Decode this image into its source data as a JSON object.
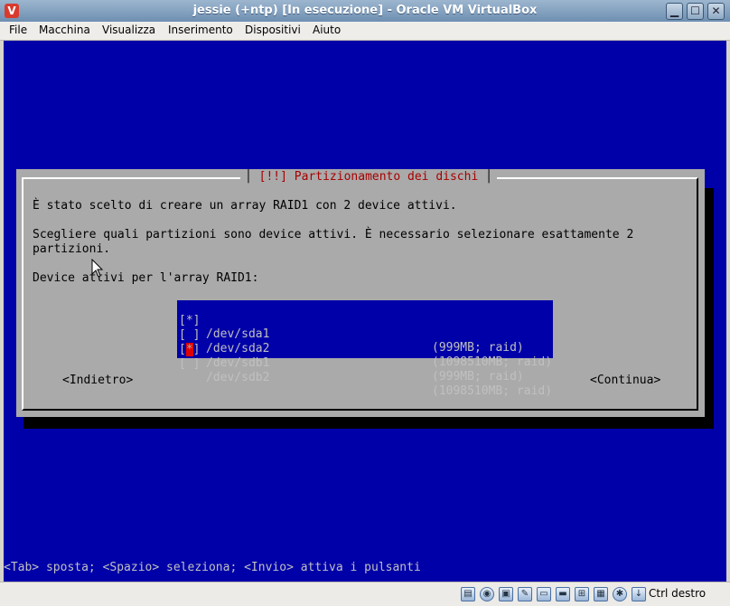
{
  "window": {
    "title": "jessie (+ntp) [In esecuzione] - Oracle VM VirtualBox",
    "app_icon": "virtualbox-icon",
    "controls": [
      "minimize",
      "maximize",
      "close"
    ]
  },
  "menu": [
    "File",
    "Macchina",
    "Visualizza",
    "Inserimento",
    "Dispositivi",
    "Aiuto"
  ],
  "dialog": {
    "title_left": "[!!] ",
    "title_text": "Partizionamento dei dischi",
    "line1": "È stato scelto di creare un array RAID1 con 2 device attivi.",
    "line2a": "Scegliere quali partizioni sono device attivi. È necessario selezionare esattamente 2",
    "line2b": "partizioni.",
    "line3": "Device attivi per l'array RAID1:",
    "partitions": [
      {
        "check": "[*]",
        "device": "/dev/sda1",
        "info": "(999MB; raid)"
      },
      {
        "check": "[ ]",
        "device": "/dev/sda2",
        "info": "(1098510MB; raid)"
      },
      {
        "check": "[*]",
        "device": "/dev/sdb1",
        "info": "(999MB; raid)"
      },
      {
        "check": "[ ]",
        "device": "/dev/sdb2",
        "info": "(1098510MB; raid)"
      }
    ],
    "back_button": "<Indietro>",
    "continue_button": "<Continua>"
  },
  "help_line": "<Tab> sposta; <Spazio> seleziona; <Invio> attiva i pulsanti",
  "statusbar": {
    "host_key": "Ctrl destro",
    "icons": [
      "hdd-icon",
      "cd-icon",
      "floppy-icon",
      "usb-icon",
      "shared-folder-icon",
      "display-icon",
      "network-icon",
      "video-capture-icon",
      "cpu-icon",
      "mouse-integration-icon",
      "keyboard-icon"
    ]
  }
}
